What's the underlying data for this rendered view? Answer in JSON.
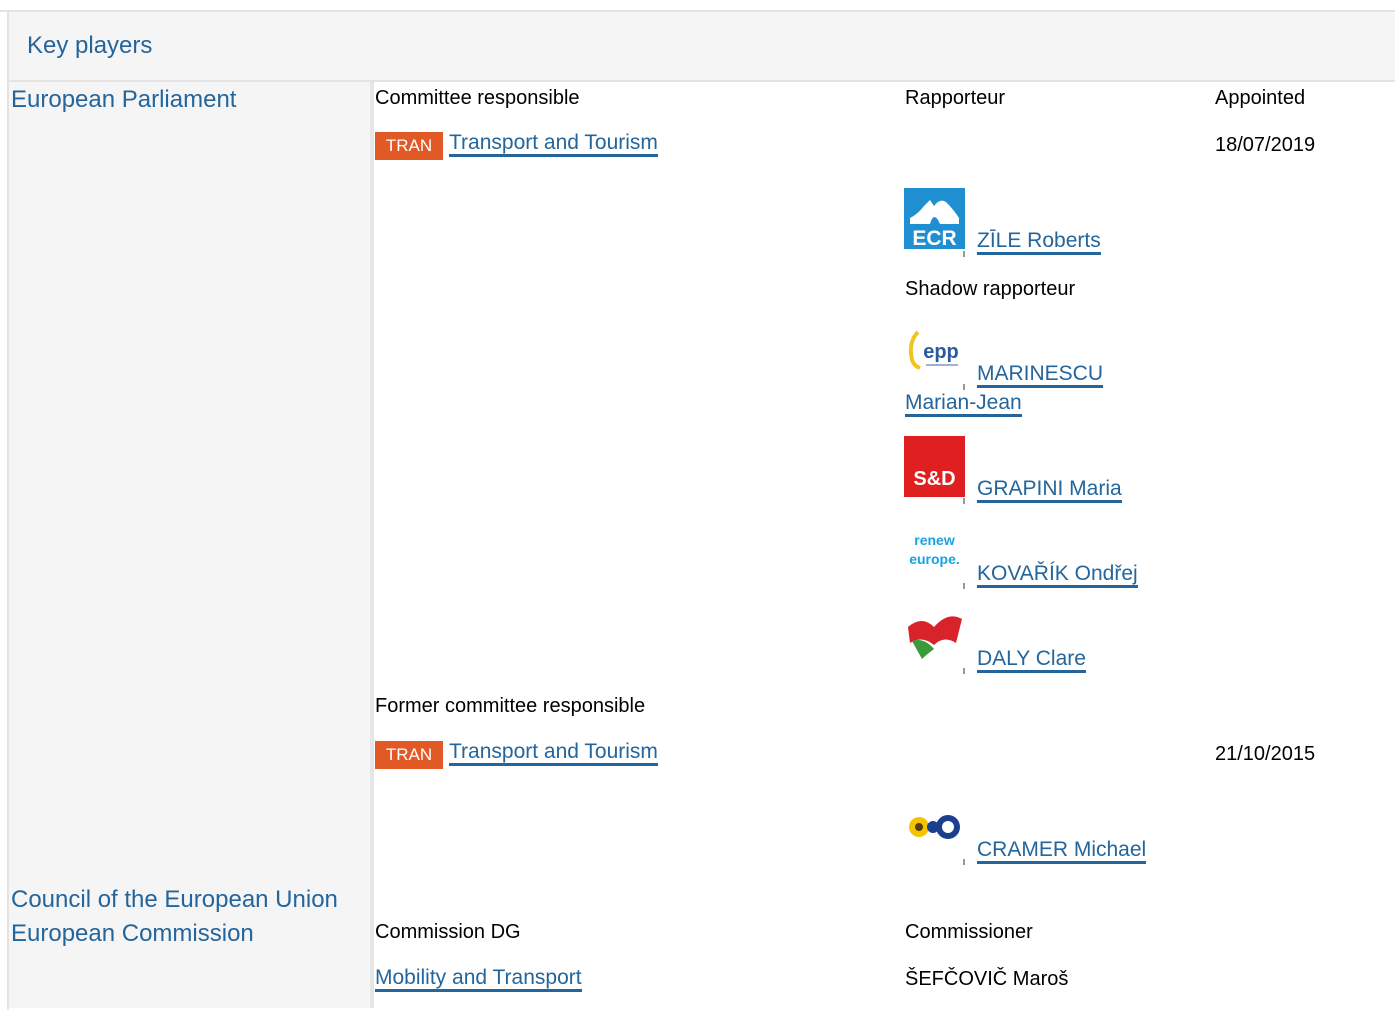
{
  "header": {
    "title": "Key players"
  },
  "institutions": {
    "parliament": "European Parliament",
    "council": "Council of the European Union",
    "commission": "European Commission"
  },
  "labels": {
    "committee_responsible": "Committee responsible",
    "rapporteur": "Rapporteur",
    "appointed": "Appointed",
    "shadow_rapporteur": "Shadow rapporteur",
    "former_committee_responsible": "Former committee responsible",
    "commission_dg": "Commission DG",
    "commissioner": "Commissioner"
  },
  "committee": {
    "code": "TRAN",
    "name": "Transport and Tourism",
    "appointed": "18/07/2019"
  },
  "former_committee": {
    "code": "TRAN",
    "name": "Transport and Tourism",
    "appointed": "21/10/2015"
  },
  "logos": {
    "ecr": "ECR",
    "epp": "epp",
    "sd": "S&D",
    "renew_1": "renew",
    "renew_2": "europe."
  },
  "rapporteur": {
    "name": "ZĪLE Roberts",
    "group_icon": "ecr-logo-icon"
  },
  "shadow_rapporteurs": [
    {
      "name_line1": "MARINESCU",
      "name_line2": "Marian-Jean",
      "group_icon": "epp-logo-icon"
    },
    {
      "name": "GRAPINI Maria",
      "group_icon": "sd-logo-icon"
    },
    {
      "name": "KOVAŘÍK Ondřej",
      "group_icon": "renew-europe-logo-icon"
    },
    {
      "name": "DALY Clare",
      "group_icon": "gue-ngl-logo-icon"
    }
  ],
  "former_rapporteur": {
    "name": "CRAMER Michael",
    "group_icon": "greens-efa-logo-icon"
  },
  "commission": {
    "dg": "Mobility and Transport",
    "commissioner": "ŠEFČOVIČ Maroš"
  },
  "colors": {
    "link": "#24659c",
    "badge": "#e15a26",
    "panel": "#f5f5f5"
  }
}
